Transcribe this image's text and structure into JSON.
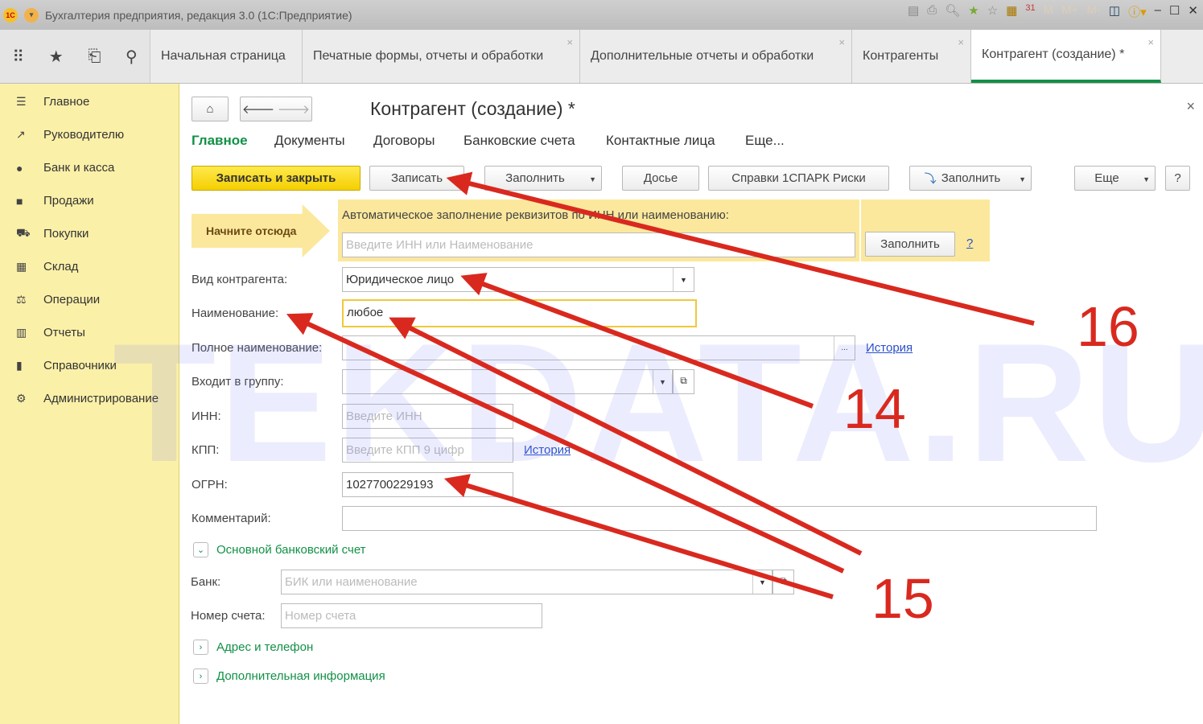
{
  "window": {
    "title": "Бухгалтерия предприятия, редакция 3.0  (1С:Предприятие)",
    "toolbar_icons": [
      "save-icon",
      "print-icon",
      "preview-icon",
      "favorite-add-icon",
      "favorite-icon",
      "calculator-icon",
      "calendar-icon",
      "memory-m-icon",
      "memory-mplus-icon",
      "memory-mminus-icon",
      "panels-icon",
      "info-icon",
      "minimize-icon",
      "maximize-icon",
      "close-icon"
    ],
    "calendar_day": "31",
    "memory_labels": [
      "M",
      "M+",
      "M-"
    ]
  },
  "tabs": [
    {
      "label": "Начальная страница",
      "closable": false
    },
    {
      "label": "Печатные формы, отчеты и обработки",
      "closable": true
    },
    {
      "label": "Дополнительные отчеты и обработки",
      "closable": true
    },
    {
      "label": "Контрагенты",
      "closable": true
    },
    {
      "label": "Контрагент (создание) *",
      "closable": true,
      "active": true
    }
  ],
  "sidebar": {
    "items": [
      {
        "label": "Главное",
        "icon": "menu-icon"
      },
      {
        "label": "Руководителю",
        "icon": "chart-line-icon"
      },
      {
        "label": "Банк и касса",
        "icon": "coin-icon"
      },
      {
        "label": "Продажи",
        "icon": "bag-icon"
      },
      {
        "label": "Покупки",
        "icon": "cart-icon"
      },
      {
        "label": "Склад",
        "icon": "warehouse-icon"
      },
      {
        "label": "Операции",
        "icon": "operations-icon"
      },
      {
        "label": "Отчеты",
        "icon": "bar-chart-icon"
      },
      {
        "label": "Справочники",
        "icon": "book-icon"
      },
      {
        "label": "Администрирование",
        "icon": "gear-icon"
      }
    ]
  },
  "form": {
    "title": "Контрагент (создание) *",
    "nav": [
      "Главное",
      "Документы",
      "Договоры",
      "Банковские счета",
      "Контактные лица",
      "Еще..."
    ],
    "toolbar": {
      "save_close": "Записать и закрыть",
      "save": "Записать",
      "fill": "Заполнить",
      "dossier": "Досье",
      "spark": "Справки 1СПАРК Риски",
      "fill2": "Заполнить",
      "more": "Еще",
      "help": "?"
    },
    "start_here": "Начните отсюда",
    "autofill": {
      "label": "Автоматическое заполнение реквизитов по ИНН или наименованию:",
      "placeholder": "Введите ИНН или Наименование",
      "button": "Заполнить",
      "help": "?"
    },
    "fields": {
      "kind": {
        "label": "Вид контрагента:",
        "value": "Юридическое лицо"
      },
      "name": {
        "label": "Наименование:",
        "value": "любое"
      },
      "full_name": {
        "label": "Полное наименование:",
        "value": "",
        "history": "История"
      },
      "group": {
        "label": "Входит в группу:",
        "value": ""
      },
      "inn": {
        "label": "ИНН:",
        "placeholder": "Введите ИНН"
      },
      "kpp": {
        "label": "КПП:",
        "placeholder": "Введите КПП 9 цифр",
        "history": "История"
      },
      "ogrn": {
        "label": "ОГРН:",
        "value": "1027700229193"
      },
      "comment": {
        "label": "Комментарий:",
        "value": ""
      }
    },
    "bank_section": {
      "title": "Основной банковский счет",
      "bank_label": "Банк:",
      "bank_placeholder": "БИК или наименование",
      "account_label": "Номер счета:",
      "account_placeholder": "Номер счета"
    },
    "sections": [
      "Адрес и телефон",
      "Дополнительная информация"
    ]
  },
  "annotations": {
    "watermark": "TEKDATA.RU",
    "numbers": [
      "16",
      "14",
      "15"
    ],
    "arrow_color": "#d9291f"
  }
}
